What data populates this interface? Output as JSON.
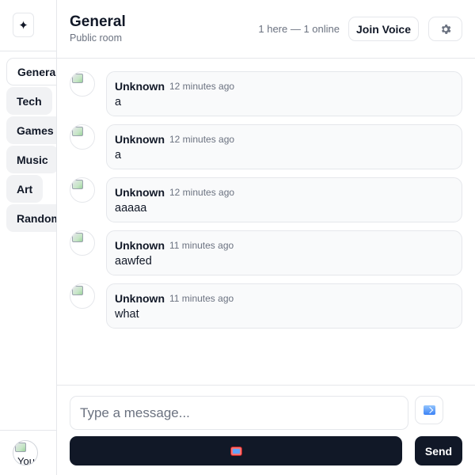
{
  "sidebar": {
    "logo_icon": "sparkle-icon",
    "channels": [
      {
        "label": "General",
        "active": true
      },
      {
        "label": "Tech",
        "active": false
      },
      {
        "label": "Games",
        "active": false
      },
      {
        "label": "Music",
        "active": false
      },
      {
        "label": "Art",
        "active": false
      },
      {
        "label": "Random",
        "active": false
      }
    ],
    "user_avatar_alt": "You"
  },
  "header": {
    "title": "General",
    "subtitle": "Public room",
    "presence": "1 here — 1 online",
    "join_voice_label": "Join Voice",
    "settings_icon": "gear-icon"
  },
  "messages": [
    {
      "author": "Unknown",
      "time": "12 minutes ago",
      "text": "a"
    },
    {
      "author": "Unknown",
      "time": "12 minutes ago",
      "text": "a"
    },
    {
      "author": "Unknown",
      "time": "12 minutes ago",
      "text": "aaaaa"
    },
    {
      "author": "Unknown",
      "time": "11 minutes ago",
      "text": "aawfed"
    },
    {
      "author": "Unknown",
      "time": "11 minutes ago",
      "text": "what"
    }
  ],
  "composer": {
    "placeholder": "Type a message...",
    "value": "",
    "attach_icon": "image-upload-icon",
    "record_icon": "television-icon",
    "send_label": "Send"
  },
  "colors": {
    "primary_dark": "#111827",
    "border": "#e5e7eb",
    "muted_text": "#6b7280",
    "bubble_bg": "#f9fafb"
  }
}
